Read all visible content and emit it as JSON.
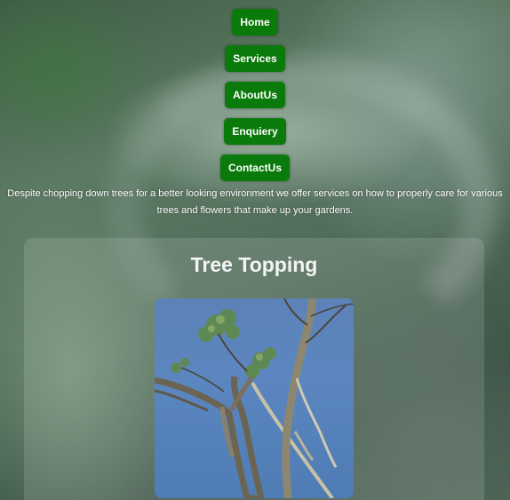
{
  "nav": {
    "items": [
      {
        "label": "Home"
      },
      {
        "label": "Services"
      },
      {
        "label": "AboutUs"
      },
      {
        "label": "Enquiery"
      },
      {
        "label": "ContactUs"
      }
    ]
  },
  "intro": {
    "text": "Despite chopping down trees for a better looking environment we offer services on how to properly care for various trees and flowers that make up your gardens."
  },
  "service_card": {
    "title": "Tree Topping",
    "image": "tree-topping-photo"
  }
}
